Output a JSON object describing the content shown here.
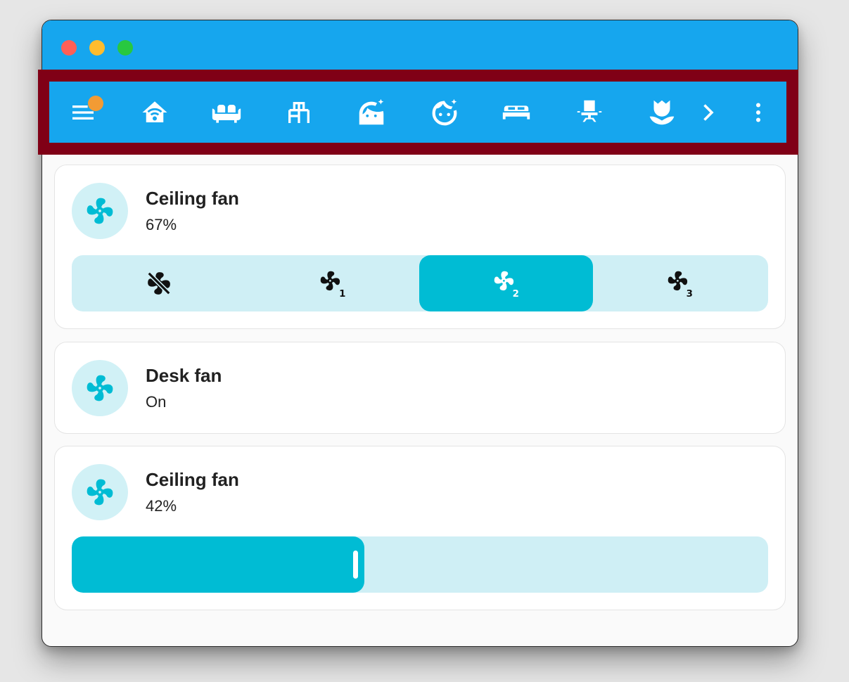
{
  "colors": {
    "titlebar": "#16a6ee",
    "toolbar": "#16a6ee",
    "toolbar_outline": "#800016",
    "badge": "#f29b34",
    "accent": "#00bcd4",
    "accent_light": "#cfeff5",
    "icon_circle": "#d1f1f6"
  },
  "window": {
    "traffic_lights": [
      "close",
      "minimize",
      "zoom"
    ]
  },
  "toolbar": {
    "items": [
      {
        "name": "menu-icon",
        "has_badge": true
      },
      {
        "name": "home-icon"
      },
      {
        "name": "sofa-icon"
      },
      {
        "name": "desk-icon"
      },
      {
        "name": "face-woman-icon"
      },
      {
        "name": "face-man-icon"
      },
      {
        "name": "bed-icon"
      },
      {
        "name": "office-chair-icon"
      },
      {
        "name": "flower-icon"
      },
      {
        "name": "chevron-right-icon"
      },
      {
        "name": "dots-vertical-icon"
      }
    ]
  },
  "cards": [
    {
      "title": "Ceiling fan",
      "state": "67%",
      "icon": "fan-icon",
      "control": "speed-presets",
      "presets": [
        {
          "name": "fan-off-icon",
          "active": false
        },
        {
          "name": "fan-speed-1-icon",
          "active": false
        },
        {
          "name": "fan-speed-2-icon",
          "active": true
        },
        {
          "name": "fan-speed-3-icon",
          "active": false
        }
      ]
    },
    {
      "title": "Desk fan",
      "state": "On",
      "icon": "fan-icon"
    },
    {
      "title": "Ceiling fan",
      "state": "42%",
      "icon": "fan-icon",
      "control": "percentage-slider",
      "slider_value_percent": 42
    }
  ]
}
